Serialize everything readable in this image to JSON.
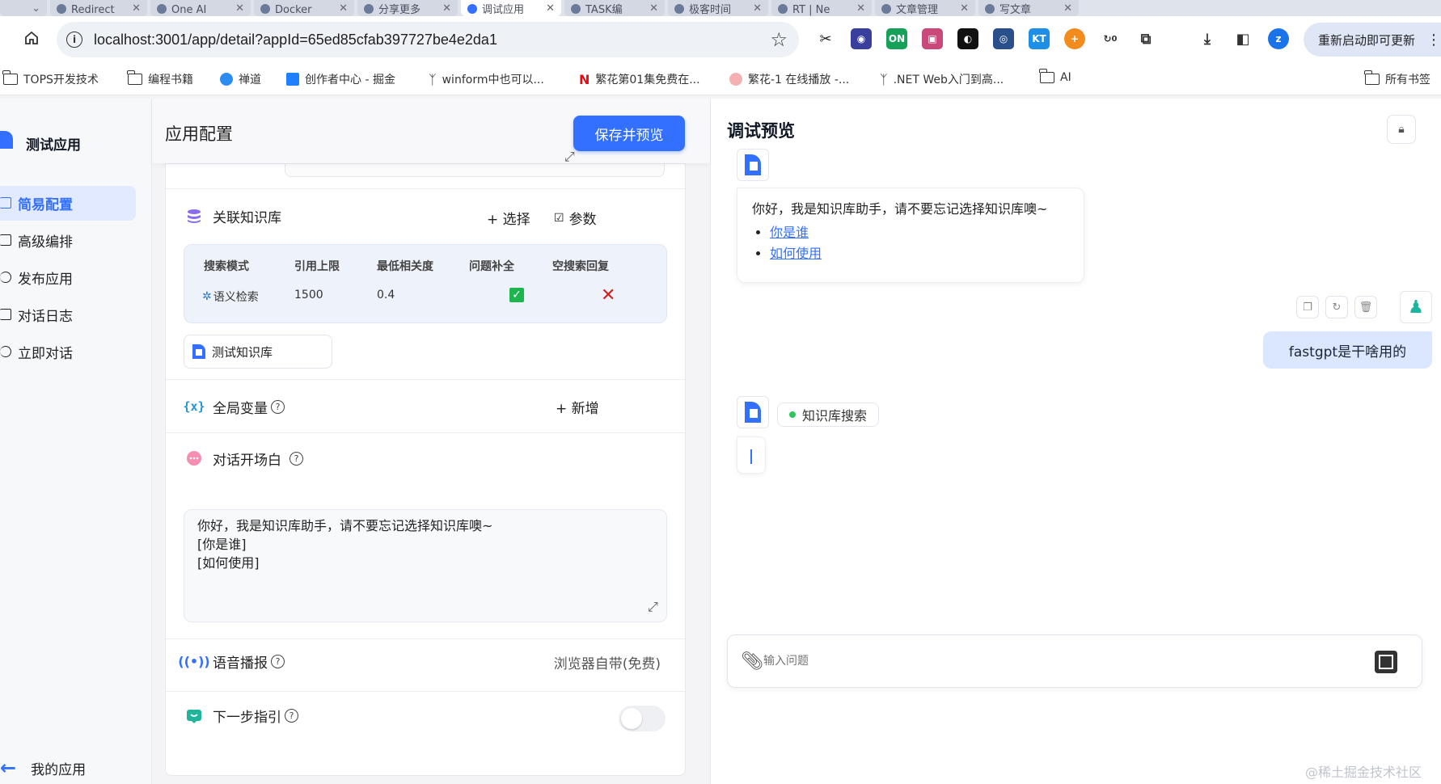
{
  "browser": {
    "tabs": [
      {
        "label": "Redirect"
      },
      {
        "label": "One AI"
      },
      {
        "label": "Docker"
      },
      {
        "label": "分享更多"
      },
      {
        "label": "调试应用"
      },
      {
        "label": "TASK编"
      },
      {
        "label": "极客时间"
      },
      {
        "label": "RT | Ne"
      },
      {
        "label": "文章管理"
      },
      {
        "label": "写文章"
      }
    ],
    "url": "localhost:3001/app/detail?appId=65ed85cfab397727be4e2da1",
    "update_label": "重新启动即可更新",
    "extension_on_badge": "ON",
    "extension_kt_badge": "KT",
    "extension_count": "0",
    "profile_initial": "z",
    "bookmarks": [
      {
        "label": "TOPS开发技术"
      },
      {
        "label": "编程书籍"
      },
      {
        "label": "禅道"
      },
      {
        "label": "创作者中心 - 掘金"
      },
      {
        "label": "winform中也可以..."
      },
      {
        "label": "繁花第01集免费在..."
      },
      {
        "label": "繁花-1 在线播放 -..."
      },
      {
        "label": ".NET Web入门到高..."
      },
      {
        "label": "AI"
      }
    ],
    "all_bookmarks": "所有书签"
  },
  "sidebar": {
    "app_name": "测试应用",
    "items": [
      {
        "label": "简易配置"
      },
      {
        "label": "高级编排"
      },
      {
        "label": "发布应用"
      },
      {
        "label": "对话日志"
      },
      {
        "label": "立即对话"
      }
    ],
    "back_label": "我的应用"
  },
  "config": {
    "title": "应用配置",
    "save_label": "保存并预览",
    "knowledge": {
      "title": "关联知识库",
      "select_label": "+ 选择",
      "params_label": "参数",
      "headers": [
        "搜索模式",
        "引用上限",
        "最低相关度",
        "问题补全",
        "空搜索回复"
      ],
      "row": {
        "mode": "语义检索",
        "limit": "1500",
        "similarity": "0.4"
      },
      "dataset_name": "测试知识库"
    },
    "variables": {
      "title": "全局变量",
      "add_label": "+ 新增"
    },
    "welcome": {
      "title": "对话开场白",
      "text": "你好，我是知识库助手，请不要忘记选择知识库噢~\n[你是谁]\n[如何使用]"
    },
    "tts": {
      "title": "语音播报",
      "value": "浏览器自带(免费)"
    },
    "next_guide": {
      "title": "下一步指引"
    }
  },
  "preview": {
    "title": "调试预览",
    "bot_greeting": "你好，我是知识库助手，请不要忘记选择知识库噢~",
    "quick_questions": [
      "你是谁",
      "如何使用"
    ],
    "user_message": "fastgpt是干啥用的",
    "status_label": "知识库搜索",
    "input_placeholder": "输入问题"
  },
  "watermark": "@稀土掘金技术社区",
  "colors": {
    "accent": "#3370ff",
    "user_bubble": "#dbe6ff",
    "status_dot": "#2cc55d"
  }
}
